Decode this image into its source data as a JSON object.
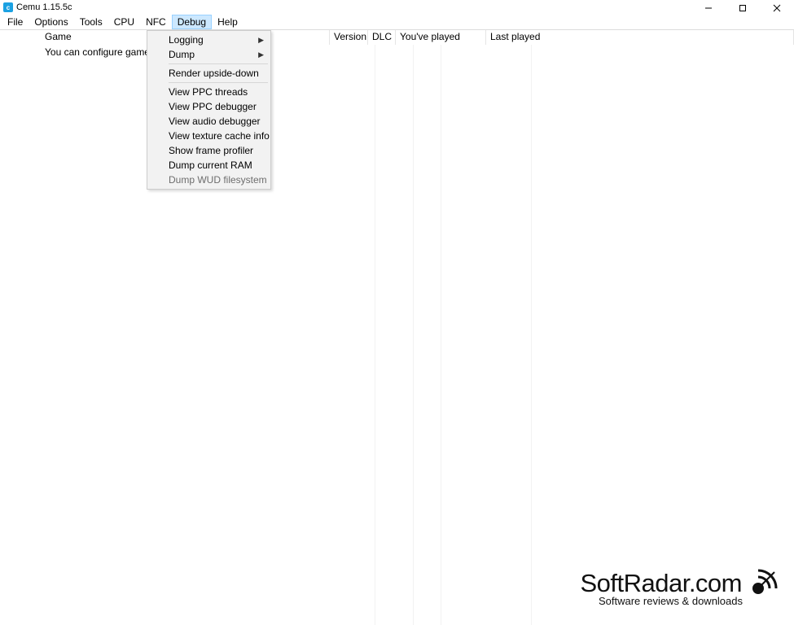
{
  "title": "Cemu 1.15.5c",
  "menubar": [
    "File",
    "Options",
    "Tools",
    "CPU",
    "NFC",
    "Debug",
    "Help"
  ],
  "active_menu_index": 5,
  "columns": {
    "game": "Game",
    "version": "Version",
    "dlc": "DLC",
    "youplayed": "You've played",
    "lastplayed": "Last played"
  },
  "placeholder": "You can configure game",
  "debug_menu": [
    {
      "label": "Logging",
      "submenu": true
    },
    {
      "label": "Dump",
      "submenu": true
    },
    {
      "sep": true
    },
    {
      "label": "Render upside-down"
    },
    {
      "sep": true
    },
    {
      "label": "View PPC threads"
    },
    {
      "label": "View PPC debugger"
    },
    {
      "label": "View audio debugger"
    },
    {
      "label": "View texture cache info"
    },
    {
      "label": "Show frame profiler"
    },
    {
      "label": "Dump current RAM"
    },
    {
      "label": "Dump WUD filesystem",
      "disabled": true
    }
  ],
  "watermark": {
    "brand": "SoftRadar.com",
    "sub": "Software reviews & downloads"
  }
}
